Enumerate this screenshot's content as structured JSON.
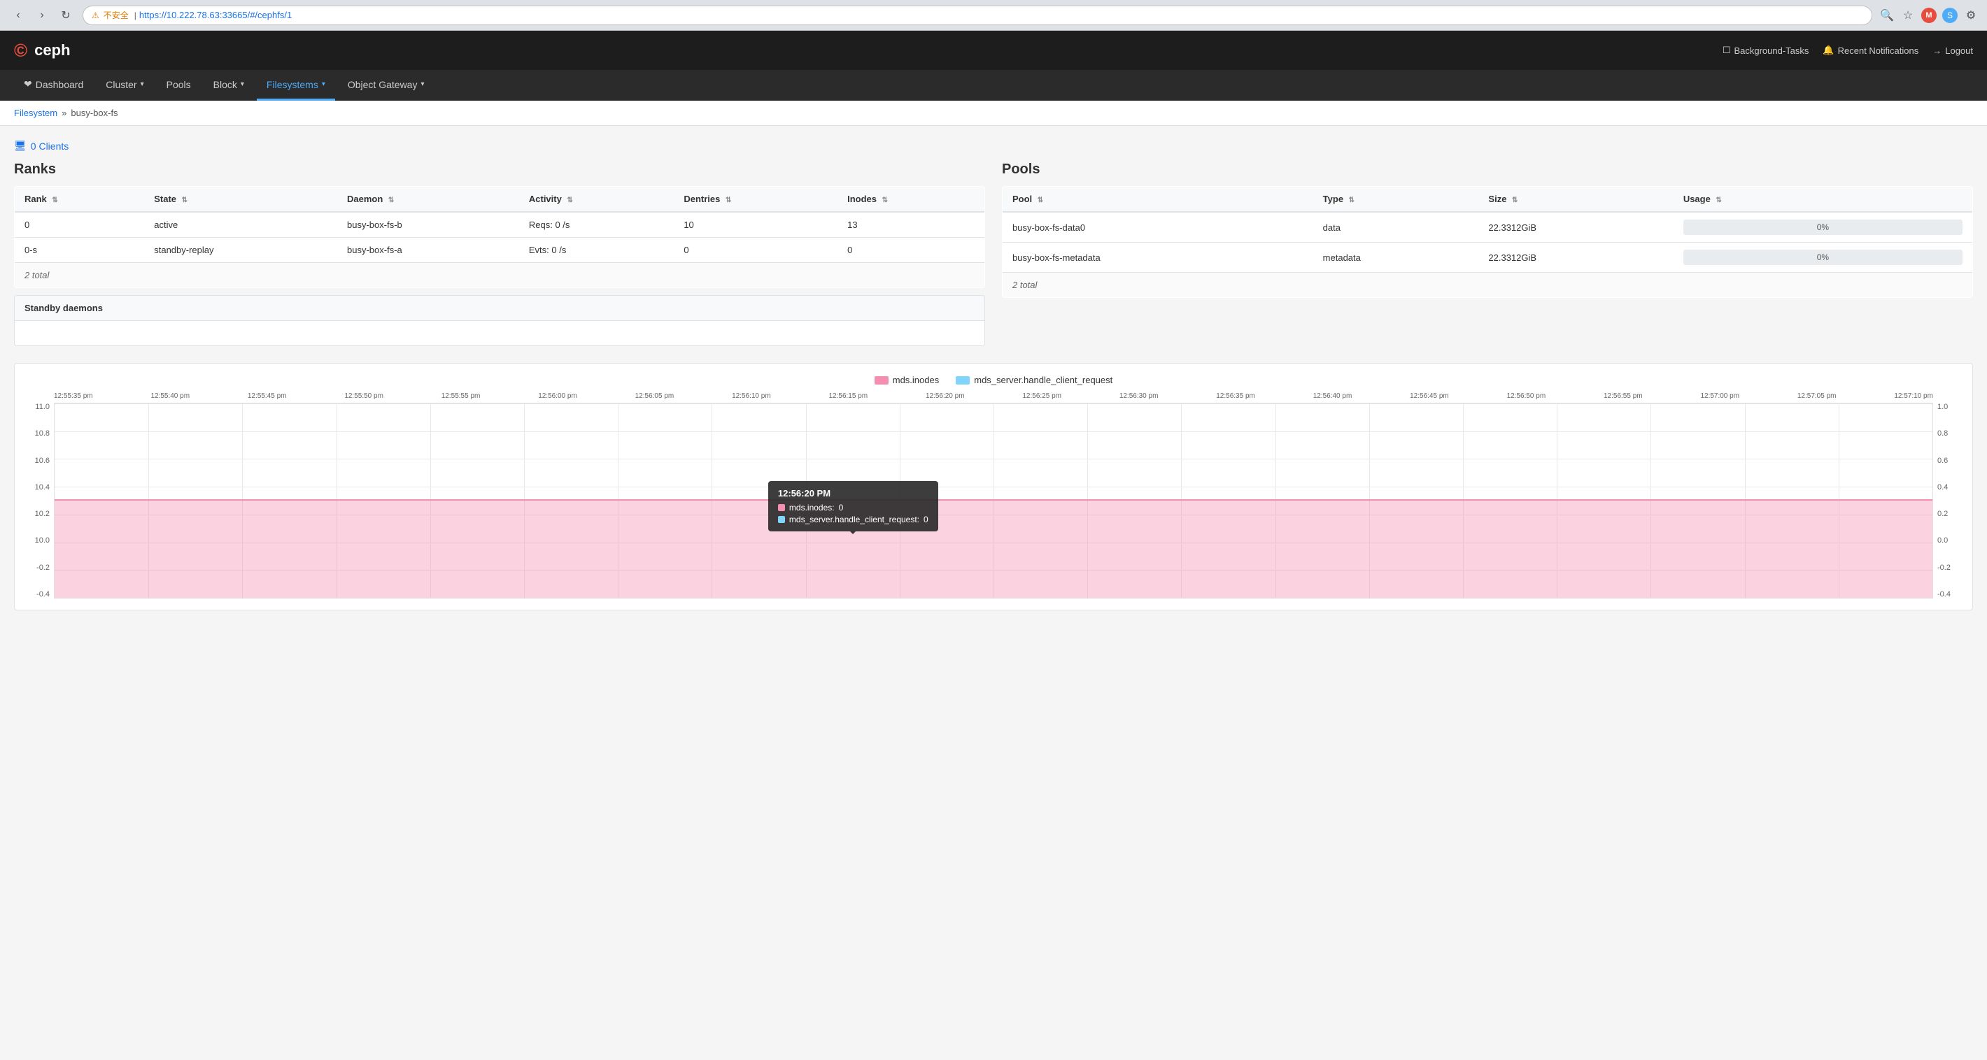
{
  "browser": {
    "url": "https://10.222.78.63:33665/#/cephfs/1",
    "warning_text": "不安全",
    "warning_icon": "⚠"
  },
  "header": {
    "logo": "ceph",
    "logo_icon": "©",
    "background_tasks_label": "Background-Tasks",
    "notifications_label": "Recent Notifications",
    "logout_label": "Logout"
  },
  "nav": {
    "items": [
      {
        "label": "Dashboard",
        "icon": "❤",
        "active": false,
        "has_dropdown": false
      },
      {
        "label": "Cluster",
        "active": false,
        "has_dropdown": true
      },
      {
        "label": "Pools",
        "active": false,
        "has_dropdown": false
      },
      {
        "label": "Block",
        "active": false,
        "has_dropdown": true
      },
      {
        "label": "Filesystems",
        "active": true,
        "has_dropdown": true
      },
      {
        "label": "Object Gateway",
        "active": false,
        "has_dropdown": true
      }
    ]
  },
  "breadcrumb": {
    "parent": "Filesystem",
    "separator": "»",
    "current": "busy-box-fs"
  },
  "clients": {
    "count": 0,
    "label": "0 Clients",
    "icon": "🖥"
  },
  "ranks_section": {
    "title": "Ranks",
    "columns": [
      "Rank",
      "State",
      "Daemon",
      "Activity",
      "Dentries",
      "Inodes"
    ],
    "rows": [
      {
        "rank": "0",
        "state": "active",
        "daemon": "busy-box-fs-b",
        "activity": "Reqs: 0 /s",
        "dentries": "10",
        "inodes": "13"
      },
      {
        "rank": "0-s",
        "state": "standby-replay",
        "daemon": "busy-box-fs-a",
        "activity": "Evts: 0 /s",
        "dentries": "0",
        "inodes": "0"
      }
    ],
    "total": "2 total",
    "standby_label": "Standby daemons"
  },
  "pools_section": {
    "title": "Pools",
    "columns": [
      "Pool",
      "Type",
      "Size",
      "Usage"
    ],
    "rows": [
      {
        "pool": "busy-box-fs-data0",
        "type": "data",
        "size": "22.3312GiB",
        "usage": "0%",
        "usage_pct": 0
      },
      {
        "pool": "busy-box-fs-metadata",
        "type": "metadata",
        "size": "22.3312GiB",
        "usage": "0%",
        "usage_pct": 0
      }
    ],
    "total": "2 total"
  },
  "chart": {
    "legend": [
      {
        "label": "mds.inodes",
        "color": "pink"
      },
      {
        "label": "mds_server.handle_client_request",
        "color": "blue"
      }
    ],
    "time_labels": [
      "12:55:35 pm",
      "12:55:40 pm",
      "12:55:45 pm",
      "12:55:50 pm",
      "12:55:55 pm",
      "12:56:00 pm",
      "12:56:05 pm",
      "12:56:10 pm",
      "12:56:15 pm",
      "12:56:20 pm",
      "12:56:25 pm",
      "12:56:30 pm",
      "12:56:35 pm",
      "12:56:40 pm",
      "12:56:45 pm",
      "12:56:50 pm",
      "12:56:55 pm",
      "12:57:00 pm",
      "12:57:05 pm",
      "12:57:10 pm"
    ],
    "y_left": [
      "11.0",
      "10.8",
      "10.6",
      "10.4",
      "10.2",
      "10.0",
      "-0.2",
      "-0.4"
    ],
    "y_right": [
      "1.0",
      "0.8",
      "0.6",
      "0.4",
      "0.2",
      "0.0",
      "-0.2",
      "-0.4"
    ],
    "tooltip": {
      "time": "12:56:20 PM",
      "mds_inodes_label": "mds.inodes:",
      "mds_inodes_value": "0",
      "handle_label": "mds_server.handle_client_request:",
      "handle_value": "0"
    }
  }
}
